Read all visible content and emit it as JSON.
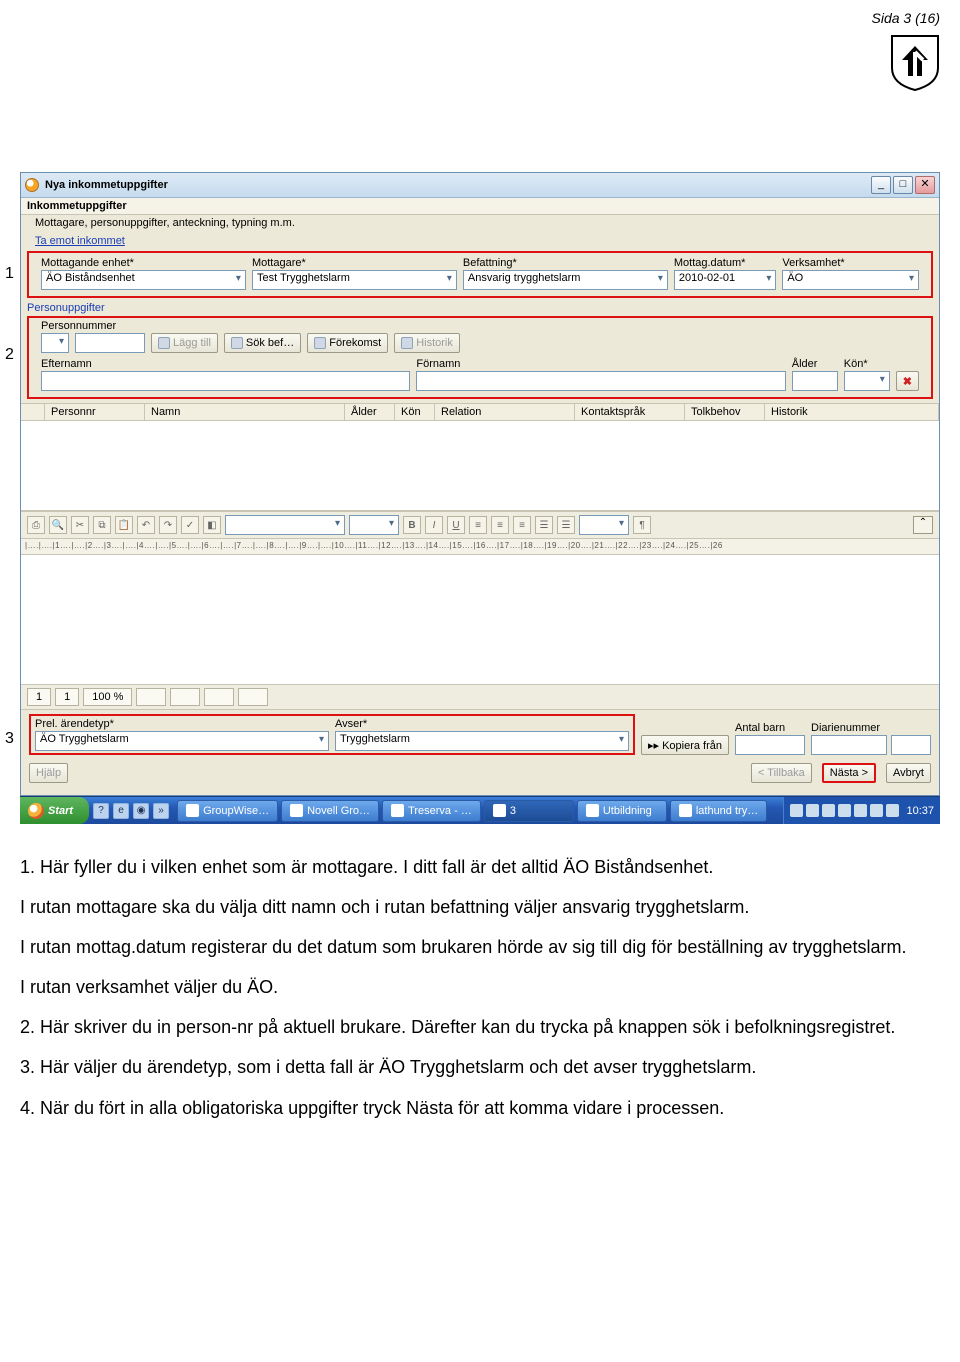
{
  "page": {
    "side": "Sida 3 (16)"
  },
  "window": {
    "title": "Nya inkommetuppgifter",
    "section": "Inkommetuppgifter",
    "sub": "Mottagare, personuppgifter, anteckning, typning m.m.",
    "link_ta_emot": "Ta emot inkommet",
    "grp_person": "Personuppgifter"
  },
  "row1": {
    "mottag_enhet_lbl": "Mottagande enhet*",
    "mottag_enhet_val": "ÄO Biståndsenhet",
    "mottagare_lbl": "Mottagare*",
    "mottagare_val": "Test Trygghetslarm",
    "befattning_lbl": "Befattning*",
    "befattning_val": "Ansvarig trygghetslarm",
    "datum_lbl": "Mottag.datum*",
    "datum_val": "2010-02-01",
    "verksamhet_lbl": "Verksamhet*",
    "verksamhet_val": "ÄO"
  },
  "row2": {
    "personnr_lbl": "Personnummer",
    "lagg_till": "Lägg till",
    "sok_bef": "Sök bef…",
    "forekomst": "Förekomst",
    "historik_btn": "Historik",
    "efternamn_lbl": "Efternamn",
    "fornamn_lbl": "Förnamn",
    "alder_lbl": "Ålder",
    "kon_lbl": "Kön*"
  },
  "table": {
    "personnr": "Personnr",
    "namn": "Namn",
    "alder": "Ålder",
    "kon": "Kön",
    "relation": "Relation",
    "kontaktsprak": "Kontaktspråk",
    "tolkbehov": "Tolkbehov",
    "historik": "Historik"
  },
  "status": {
    "a": "1",
    "b": "1",
    "c": "100 %"
  },
  "row3": {
    "arendetyp_lbl": "Prel. ärendetyp*",
    "arendetyp_val": "ÄO Trygghetslarm",
    "avser_lbl": "Avser*",
    "avser_val": "Trygghetslarm",
    "kopiera": "▸▸ Kopiera från",
    "antal_barn": "Antal barn",
    "diarienummer": "Diarienummer"
  },
  "nav": {
    "hjalp": "Hjälp",
    "tillbaka": "< Tillbaka",
    "nasta": "Nästa >",
    "avbryt": "Avbryt"
  },
  "taskbar": {
    "start": "Start",
    "groupwise": "GroupWise…",
    "novell": "Novell Gro…",
    "treserva": "Treserva - …",
    "three": "3",
    "utbildning": "Utbildning",
    "lathund": "lathund try…",
    "clock": "10:37"
  },
  "ruler": "|….|….|1….|….|2….|3….|….|4….|….|5….|….|6….|….|7….|….|8….|….|9….|….|10….|11….|12….|13….|14….|15….|16….|17….|18….|19….|20….|21….|22….|23….|24….|25….|26",
  "annotations": {
    "one": "1",
    "two": "2",
    "three": "3"
  },
  "body": {
    "p1a": "1. Här fyller du i vilken enhet som är mottagare. I ditt fall är det alltid ÄO Biståndsenhet.",
    "p1b": "I rutan mottagare ska du välja ditt namn och i rutan befattning väljer ansvarig trygghetslarm.",
    "p1c": "I rutan mottag.datum registerar du det datum som brukaren hörde av sig till dig för beställning av trygghetslarm.",
    "p1d": "I rutan verksamhet väljer du ÄO.",
    "p2": "2. Här skriver du in person-nr på aktuell brukare. Därefter kan du trycka på knappen sök i befolkningsregistret.",
    "p3": "3. Här väljer du ärendetyp, som i detta fall är ÄO Trygghetslarm och det avser trygghetslarm.",
    "p4": "4. När du fört in alla obligatoriska uppgifter tryck Nästa för att komma vidare i processen."
  }
}
